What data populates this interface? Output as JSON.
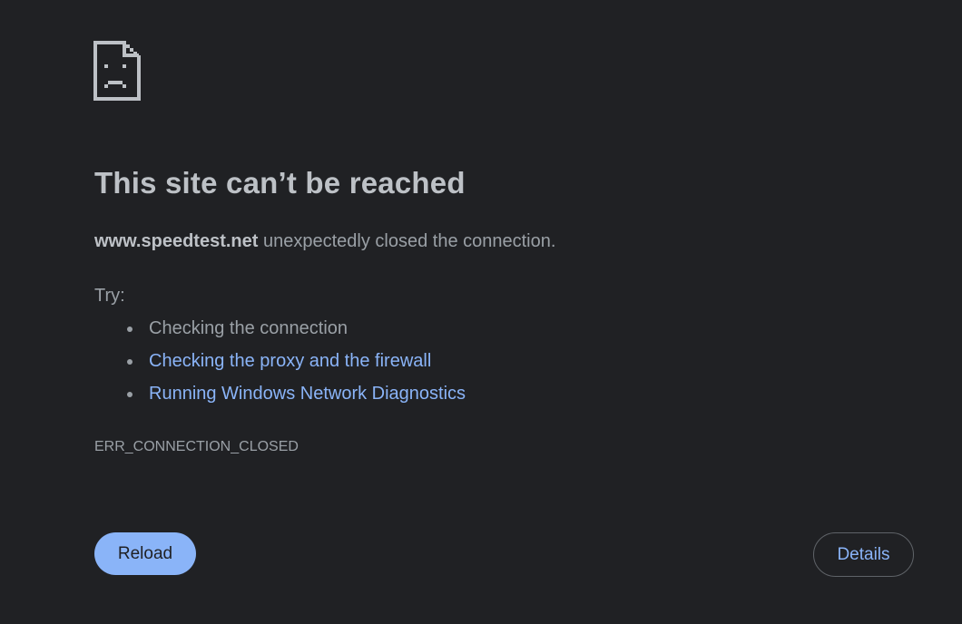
{
  "error": {
    "icon": "sad-document-icon",
    "title": "This site can’t be reached",
    "host": "www.speedtest.net",
    "message": " unexpectedly closed the connection.",
    "try_label": "Try:",
    "suggestions": [
      {
        "label": "Checking the connection",
        "link": false
      },
      {
        "label": "Checking the proxy and the firewall",
        "link": true
      },
      {
        "label": "Running Windows Network Diagnostics",
        "link": true
      }
    ],
    "code": "ERR_CONNECTION_CLOSED"
  },
  "buttons": {
    "reload_label": "Reload",
    "details_label": "Details"
  },
  "colors": {
    "background": "#202124",
    "title_text": "#bdc1c6",
    "body_text": "#9aa0a6",
    "link": "#8ab4f8",
    "primary_button": "#8ab4f8"
  }
}
